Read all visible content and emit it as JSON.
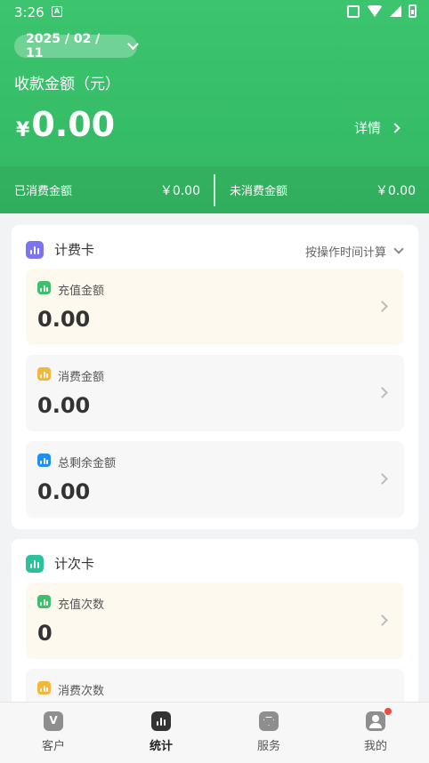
{
  "status_bar": {
    "time": "3:26",
    "notif_letter": "A"
  },
  "header": {
    "date": "2025 / 02 / 11",
    "amount_title": "收款金额（元）",
    "currency": "¥",
    "amount": "0.00",
    "detail_label": "详情",
    "consumed_label": "已消费金额",
    "consumed_value": "￥0.00",
    "unconsumed_label": "未消费金额",
    "unconsumed_value": "￥0.00"
  },
  "billing_card": {
    "title": "计费卡",
    "sort_label": "按操作时间计算",
    "metrics": [
      {
        "label": "充值金额",
        "value": "0.00"
      },
      {
        "label": "消费金额",
        "value": "0.00"
      },
      {
        "label": "总剩余金额",
        "value": "0.00"
      }
    ]
  },
  "count_card": {
    "title": "计次卡",
    "metrics": [
      {
        "label": "充值次数",
        "value": "0"
      },
      {
        "label": "消费次数",
        "value": ""
      }
    ]
  },
  "tabbar": {
    "tabs": [
      {
        "label": "客户",
        "icon": "vip-icon"
      },
      {
        "label": "统计",
        "icon": "stats-icon",
        "active": true
      },
      {
        "label": "服务",
        "icon": "diamond-icon"
      },
      {
        "label": "我的",
        "icon": "user-icon",
        "badge": true
      }
    ]
  },
  "colors": {
    "brand_green": "#3cc46e",
    "purple": "#7b74ee",
    "teal": "#2cc19a",
    "orange": "#f4b73a",
    "blue": "#1e8ff0",
    "badge_red": "#f04a3e"
  }
}
